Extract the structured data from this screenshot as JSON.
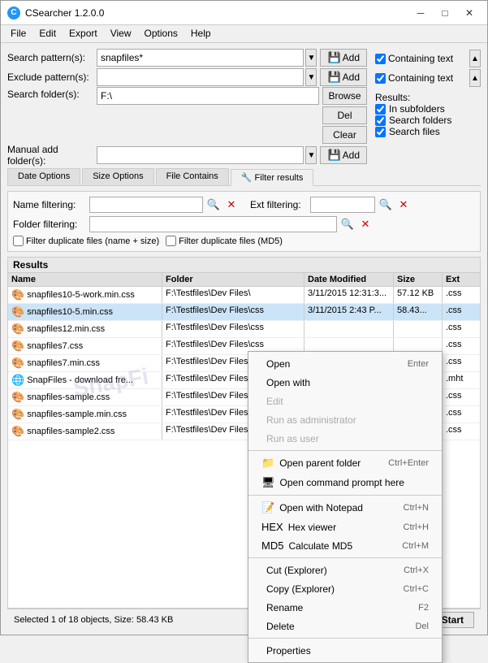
{
  "window": {
    "title": "CSearcher 1.2.0.0",
    "icon": "C"
  },
  "menu": {
    "items": [
      "File",
      "Edit",
      "Export",
      "View",
      "Options",
      "Help"
    ]
  },
  "form": {
    "search_pattern_label": "Search pattern(s):",
    "search_pattern_value": "snapfiles*",
    "exclude_pattern_label": "Exclude pattern(s):",
    "exclude_pattern_value": "",
    "search_folder_label": "Search folder(s):",
    "search_folder_value": "F:\\",
    "manual_add_label": "Manual add folder(s):",
    "manual_add_value": "",
    "add_label": "Add",
    "browse_label": "Browse",
    "del_label": "Del",
    "clear_label": "Clear"
  },
  "options": {
    "containing_text_1_checked": true,
    "containing_text_1_label": "Containing text",
    "containing_text_2_checked": true,
    "containing_text_2_label": "Containing text",
    "results_label": "Results:",
    "in_subfolders_checked": true,
    "in_subfolders_label": "In subfolders",
    "search_folders_checked": true,
    "search_folders_label": "Search folders",
    "search_files_checked": true,
    "search_files_label": "Search files"
  },
  "tabs": [
    {
      "label": "Date Options",
      "active": false
    },
    {
      "label": "Size Options",
      "active": false
    },
    {
      "label": "File Contains",
      "active": false
    },
    {
      "label": "🔧 Filter results",
      "active": true
    }
  ],
  "filter": {
    "name_label": "Name filtering:",
    "name_value": "",
    "ext_label": "Ext filtering:",
    "ext_value": "",
    "folder_label": "Folder filtering:",
    "folder_value": "",
    "dedup1_label": "Filter duplicate files (name + size)",
    "dedup2_label": "Filter duplicate files (MD5)"
  },
  "results": {
    "header": "Results",
    "columns": [
      "Name",
      "Folder",
      "Date Modified",
      "Size",
      "Ext"
    ],
    "rows": [
      {
        "name": "snapfiles10-5-work.min.css",
        "folder": "F:\\Testfiles\\Dev Files\\",
        "date": "3/11/2015 12:31:3...",
        "size": "57.12 KB",
        "ext": ".css",
        "selected": false
      },
      {
        "name": "snapfiles10-5.min.css",
        "folder": "F:\\Testfiles\\Dev Files\\css",
        "date": "3/11/2015 2:43 P...",
        "size": "58.43...",
        "ext": ".css",
        "selected": true
      },
      {
        "name": "snapfiles12.min.css",
        "folder": "F:\\Testfiles\\Dev Files\\css",
        "date": "",
        "size": "",
        "ext": ".css",
        "selected": false
      },
      {
        "name": "snapfiles7.css",
        "folder": "F:\\Testfiles\\Dev Files\\css",
        "date": "",
        "size": "",
        "ext": ".css",
        "selected": false
      },
      {
        "name": "snapfiles7.min.css",
        "folder": "F:\\Testfiles\\Dev Files\\css",
        "date": "",
        "size": "",
        "ext": ".css",
        "selected": false
      },
      {
        "name": "SnapFiles - download fre...",
        "folder": "F:\\Testfiles\\Dev Files\\",
        "date": "",
        "size": "",
        "ext": ".mht",
        "selected": false
      },
      {
        "name": "snapfiles-sample.css",
        "folder": "F:\\Testfiles\\Dev Files\\htm",
        "date": "",
        "size": "",
        "ext": ".css",
        "selected": false
      },
      {
        "name": "snapfiles-sample.min.css",
        "folder": "F:\\Testfiles\\Dev Files\\htm",
        "date": "",
        "size": "",
        "ext": ".css",
        "selected": false
      },
      {
        "name": "snapfiles-sample2.css",
        "folder": "F:\\Testfiles\\Dev Files\\htm",
        "date": "",
        "size": "",
        "ext": ".css",
        "selected": false
      }
    ]
  },
  "status": {
    "text": "Selected 1 of 18 objects, Size: 58.43 KB",
    "start_label": "Start"
  },
  "context_menu": {
    "items": [
      {
        "label": "Open",
        "shortcut": "Enter",
        "disabled": false,
        "icon": ""
      },
      {
        "label": "Open with",
        "shortcut": "",
        "disabled": false,
        "icon": ""
      },
      {
        "label": "Edit",
        "shortcut": "",
        "disabled": true,
        "icon": ""
      },
      {
        "label": "Run as administrator",
        "shortcut": "",
        "disabled": true,
        "icon": ""
      },
      {
        "label": "Run as user",
        "shortcut": "",
        "disabled": true,
        "icon": ""
      },
      {
        "separator": true
      },
      {
        "label": "Open parent folder",
        "shortcut": "Ctrl+Enter",
        "disabled": false,
        "icon": "📁"
      },
      {
        "label": "Open command prompt here",
        "shortcut": "",
        "disabled": false,
        "icon": "🖥"
      },
      {
        "separator": true
      },
      {
        "label": "Open with Notepad",
        "shortcut": "Ctrl+N",
        "disabled": false,
        "icon": "📝"
      },
      {
        "label": "Hex viewer",
        "shortcut": "Ctrl+H",
        "disabled": false,
        "icon": "HEX"
      },
      {
        "label": "Calculate MD5",
        "shortcut": "Ctrl+M",
        "disabled": false,
        "icon": "MD5"
      },
      {
        "separator": true
      },
      {
        "label": "Cut (Explorer)",
        "shortcut": "Ctrl+X",
        "disabled": false,
        "icon": ""
      },
      {
        "label": "Copy (Explorer)",
        "shortcut": "Ctrl+C",
        "disabled": false,
        "icon": ""
      },
      {
        "label": "Rename",
        "shortcut": "F2",
        "disabled": false,
        "icon": ""
      },
      {
        "label": "Delete",
        "shortcut": "Del",
        "disabled": false,
        "icon": ""
      },
      {
        "separator": true
      },
      {
        "label": "Properties",
        "shortcut": "",
        "disabled": false,
        "icon": ""
      }
    ]
  }
}
